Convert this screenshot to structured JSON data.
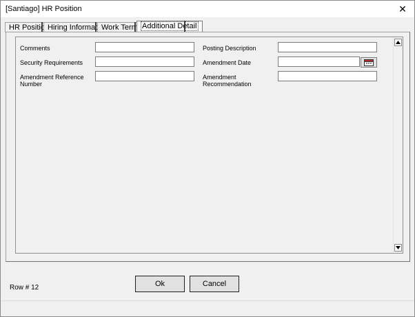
{
  "window": {
    "title": "[Santiago] HR Position",
    "close_glyph": "✕"
  },
  "tabs": [
    {
      "label": "HR Position",
      "selected": false
    },
    {
      "label": "Hiring Information",
      "selected": false
    },
    {
      "label": "Work Terms",
      "selected": false
    },
    {
      "label": "Additional Detail",
      "selected": true
    }
  ],
  "form": {
    "comments": {
      "label": "Comments",
      "value": ""
    },
    "security_requirements": {
      "label": "Security Requirements",
      "value": ""
    },
    "amendment_reference_number": {
      "label_line1": "Amendment Reference",
      "label_line2": "Number",
      "value": ""
    },
    "posting_description": {
      "label": "Posting Description",
      "value": ""
    },
    "amendment_date": {
      "label": "Amendment Date",
      "value": "",
      "picker_icon": "calendar-icon"
    },
    "amendment_recommendation": {
      "label_line1": "Amendment",
      "label_line2": "Recommendation",
      "value": ""
    }
  },
  "footer": {
    "row_count": "Row # 12",
    "ok_label": "Ok",
    "cancel_label": "Cancel"
  }
}
